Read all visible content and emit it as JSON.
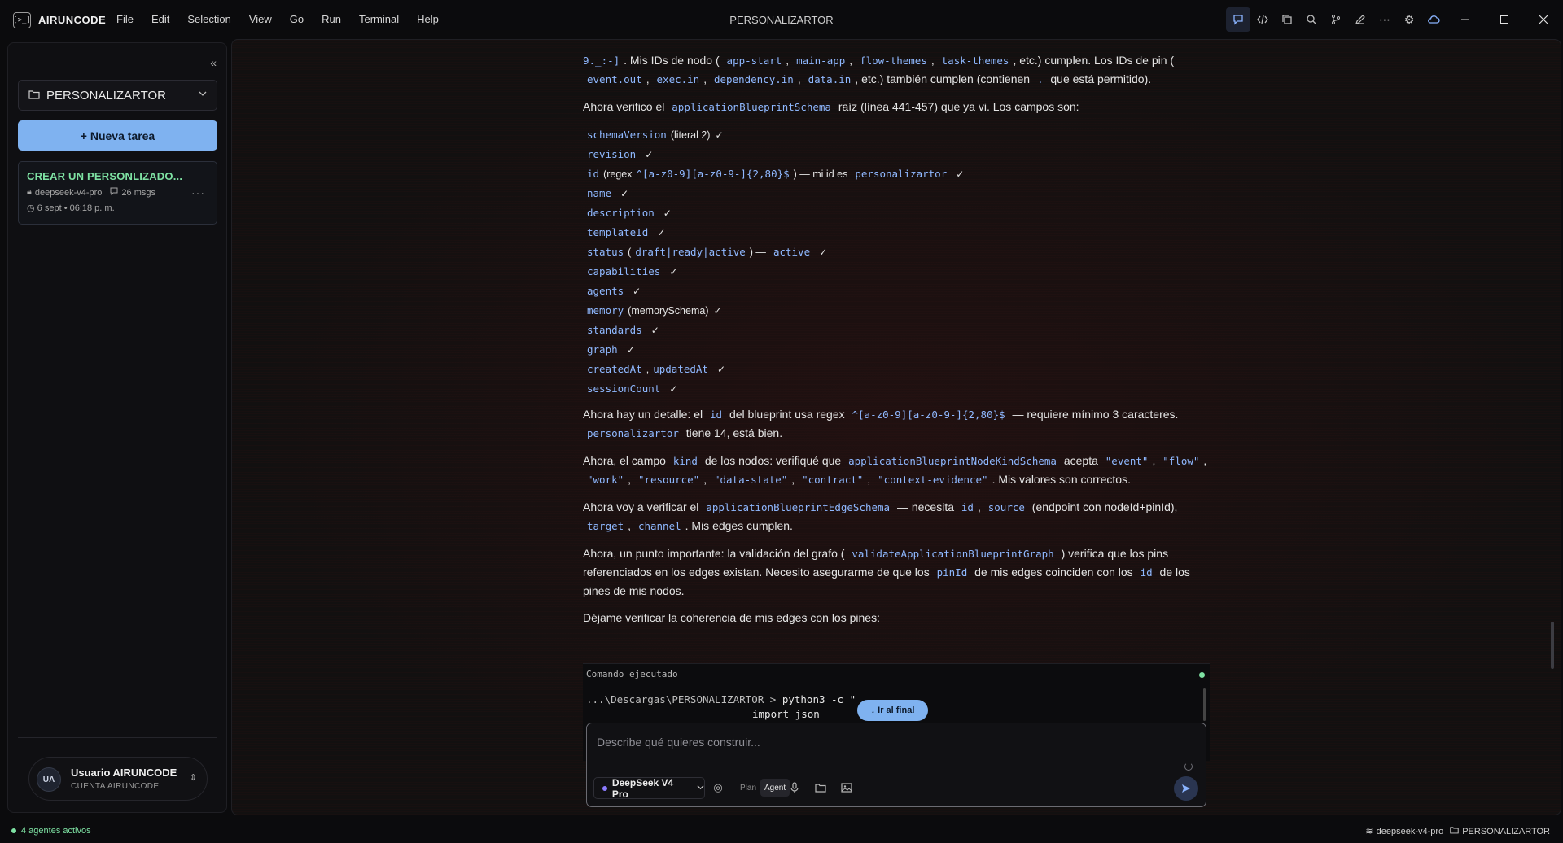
{
  "titlebar": {
    "brand": "AIRUNCODE",
    "logo_glyph": "[>_]",
    "menu": [
      "File",
      "Edit",
      "Selection",
      "View",
      "Go",
      "Run",
      "Terminal",
      "Help"
    ],
    "window_title": "PERSONALIZARTOR",
    "icons": [
      "chat-icon",
      "code-icon",
      "copy-icon",
      "search-icon",
      "branch-icon",
      "edit-icon",
      "more-icon",
      "settings-icon",
      "cloud-icon"
    ]
  },
  "sidebar": {
    "project_name": "PERSONALIZARTOR",
    "new_task_label": "+ Nueva tarea",
    "task": {
      "title": "CREAR UN PERSONLIZADO...",
      "model": "deepseek-v4-pro",
      "messages": "26 msgs",
      "date": "6 sept • 06:18 p. m."
    },
    "user": {
      "initials": "UA",
      "name": "Usuario AIRUNCODE",
      "account": "CUENTA AIRUNCODE"
    }
  },
  "content": {
    "p1": {
      "code_start": "9._:-]",
      "t1": ". Mis IDs de nodo (",
      "ids_node": [
        "app-start",
        "main-app",
        "flow-themes",
        "task-themes"
      ],
      "t2": ", etc.) cumplen. Los IDs de pin (",
      "ids_pin": [
        "event.out",
        "exec.in",
        "dependency.in",
        "data.in"
      ],
      "t3": ", etc.) también cumplen (contienen",
      "dot_code": ".",
      "t4": "que está permitido)."
    },
    "p2": {
      "t1": "Ahora verifico el",
      "code": "applicationBlueprintSchema",
      "t2": "raíz (línea 441-457) que ya vi. Los campos son:"
    },
    "fields": [
      {
        "name": "schemaVersion",
        "note": "(literal 2)"
      },
      {
        "name": "revision",
        "note": ""
      },
      {
        "name": "id",
        "note": "(regex",
        "code2": "^[a-z0-9][a-z0-9-]{2,80}$",
        "note2": ") — mi id es",
        "code3": "personalizartor"
      },
      {
        "name": "name",
        "note": ""
      },
      {
        "name": "description",
        "note": ""
      },
      {
        "name": "templateId",
        "note": ""
      },
      {
        "name": "status",
        "note": "(",
        "code2": "draft|ready|active",
        "note2": ") —",
        "code3": "active"
      },
      {
        "name": "capabilities",
        "note": ""
      },
      {
        "name": "agents",
        "note": ""
      },
      {
        "name": "memory",
        "note": "(memorySchema)"
      },
      {
        "name": "standards",
        "note": ""
      },
      {
        "name": "graph",
        "note": ""
      },
      {
        "name": "createdAt",
        "note": ",",
        "code2": "updatedAt"
      },
      {
        "name": "sessionCount",
        "note": ""
      }
    ],
    "check_mark": "✓",
    "p3": {
      "t1": "Ahora hay un detalle: el",
      "code1": "id",
      "t2": "del blueprint usa regex",
      "code2": "^[a-z0-9][a-z0-9-]{2,80}$",
      "t3": "— requiere mínimo 3 caracteres.",
      "code3": "personalizartor",
      "t4": "tiene 14, está bien."
    },
    "p4": {
      "t1": "Ahora, el campo",
      "code1": "kind",
      "t2": "de los nodos: verifiqué que",
      "code2": "applicationBlueprintNodeKindSchema",
      "t3": "acepta",
      "kinds": [
        "\"event\"",
        "\"flow\"",
        "\"work\"",
        "\"resource\"",
        "\"data-state\"",
        "\"contract\"",
        "\"context-evidence\""
      ],
      "t4": ". Mis valores son correctos."
    },
    "p5": {
      "t1": "Ahora voy a verificar el",
      "code1": "applicationBlueprintEdgeSchema",
      "t2": "— necesita",
      "code2": "id",
      "code3": "source",
      "t3": "(endpoint con nodeId+pinId),",
      "code4": "target",
      "code5": "channel",
      "t4": ". Mis edges cumplen."
    },
    "p6": {
      "t1": "Ahora, un punto importante: la validación del grafo (",
      "code1": "validateApplicationBlueprintGraph",
      "t2": ") verifica que los pins referenciados en los edges existan. Necesito asegurarme de que los",
      "code2": "pinId",
      "t3": "de mis edges coinciden con los",
      "code3": "id",
      "t4": "de los pines de mis nodos."
    },
    "p7": "Déjame verificar la coherencia de mis edges con los pines:"
  },
  "command": {
    "label": "Comando ejecutado",
    "goto_end": "↓ Ir al final",
    "prompt": "...\\Descargas\\PERSONALIZARTOR >",
    "cmd": "python3 -c \"",
    "cmd2": "import json"
  },
  "composer": {
    "placeholder": "Describe qué quieres construir...",
    "model": "DeepSeek V4 Pro",
    "mode_plan": "Plan",
    "mode_agent": "Agent"
  },
  "statusbar": {
    "agents": "4 agentes activos",
    "model": "deepseek-v4-pro",
    "project": "PERSONALIZARTOR"
  },
  "colors": {
    "accent": "#7fb2f0",
    "code": "#8fb8ff",
    "success": "#7ee2a3"
  }
}
